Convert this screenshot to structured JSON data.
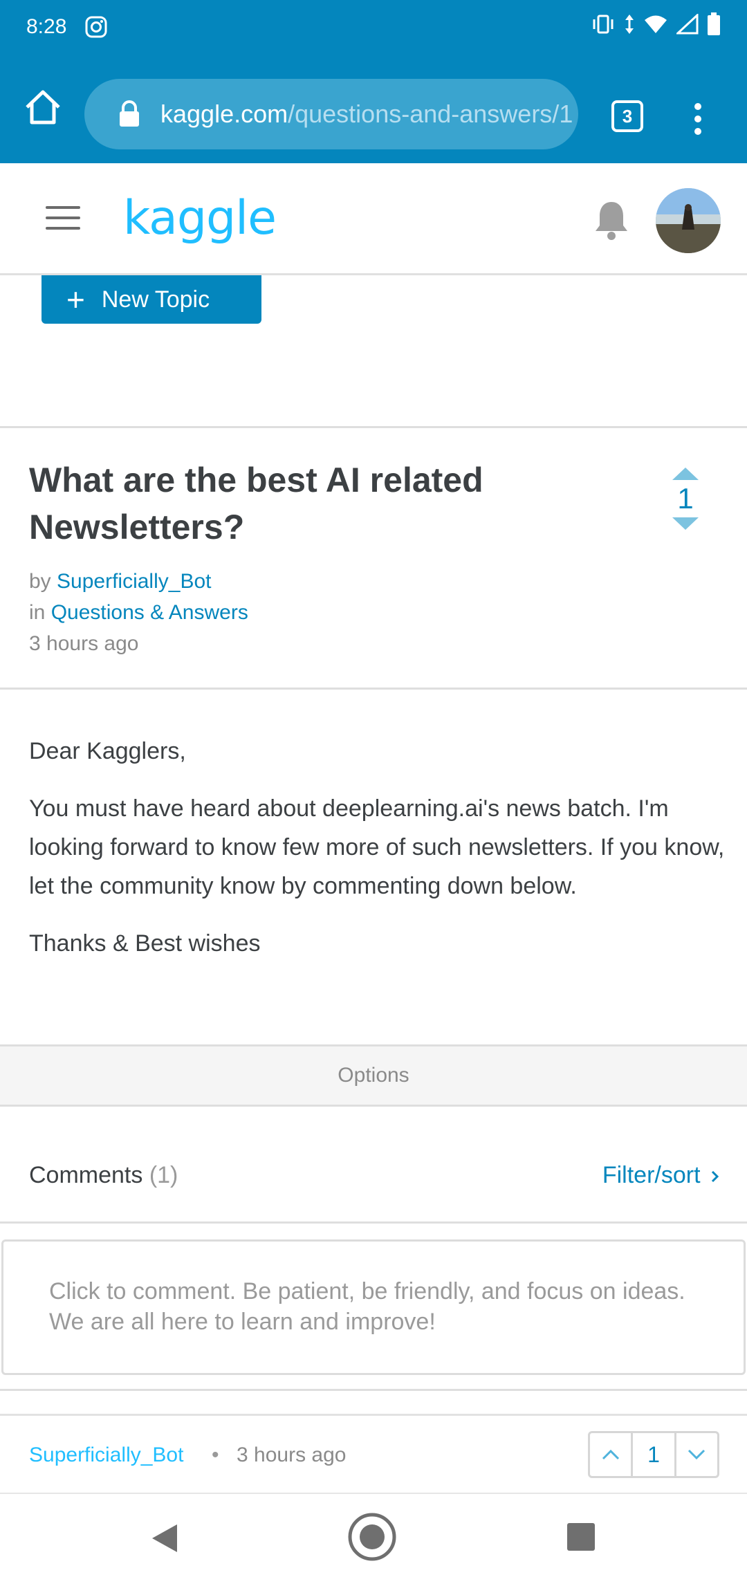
{
  "status_bar": {
    "time": "8:28",
    "icons": [
      "instagram-icon",
      "vibrate-icon",
      "data-arrows-icon",
      "wifi-icon",
      "signal-icon",
      "battery-icon"
    ]
  },
  "browser": {
    "url_host": "kaggle.com",
    "url_path": "/questions-and-answers/1",
    "tab_count": "3"
  },
  "header": {
    "logo": "kaggle"
  },
  "new_topic_label": "New Topic",
  "topic": {
    "title": "What are the best AI related Newsletters?",
    "votes": "1",
    "by_label": "by",
    "author": "Superficially_Bot",
    "in_label": "in",
    "forum": "Questions & Answers",
    "time": "3 hours ago",
    "body": [
      "Dear Kagglers,",
      "You must have heard about deeplearning.ai's news batch. I'm looking forward to know few more of such newsletters. If you know, let the community know by commenting down below.",
      "Thanks & Best wishes"
    ]
  },
  "options_label": "Options",
  "comments": {
    "heading": "Comments",
    "count": "(1)",
    "filter_label": "Filter/sort",
    "placeholder": "Click to comment. Be patient, be friendly, and focus on ideas. We are all here to learn and improve!",
    "first": {
      "author": "Superficially_Bot",
      "separator": "•",
      "time": "3 hours ago",
      "votes": "1"
    }
  },
  "colors": {
    "brand_blue": "#0486bd",
    "kaggle_cyan": "#20beff"
  }
}
